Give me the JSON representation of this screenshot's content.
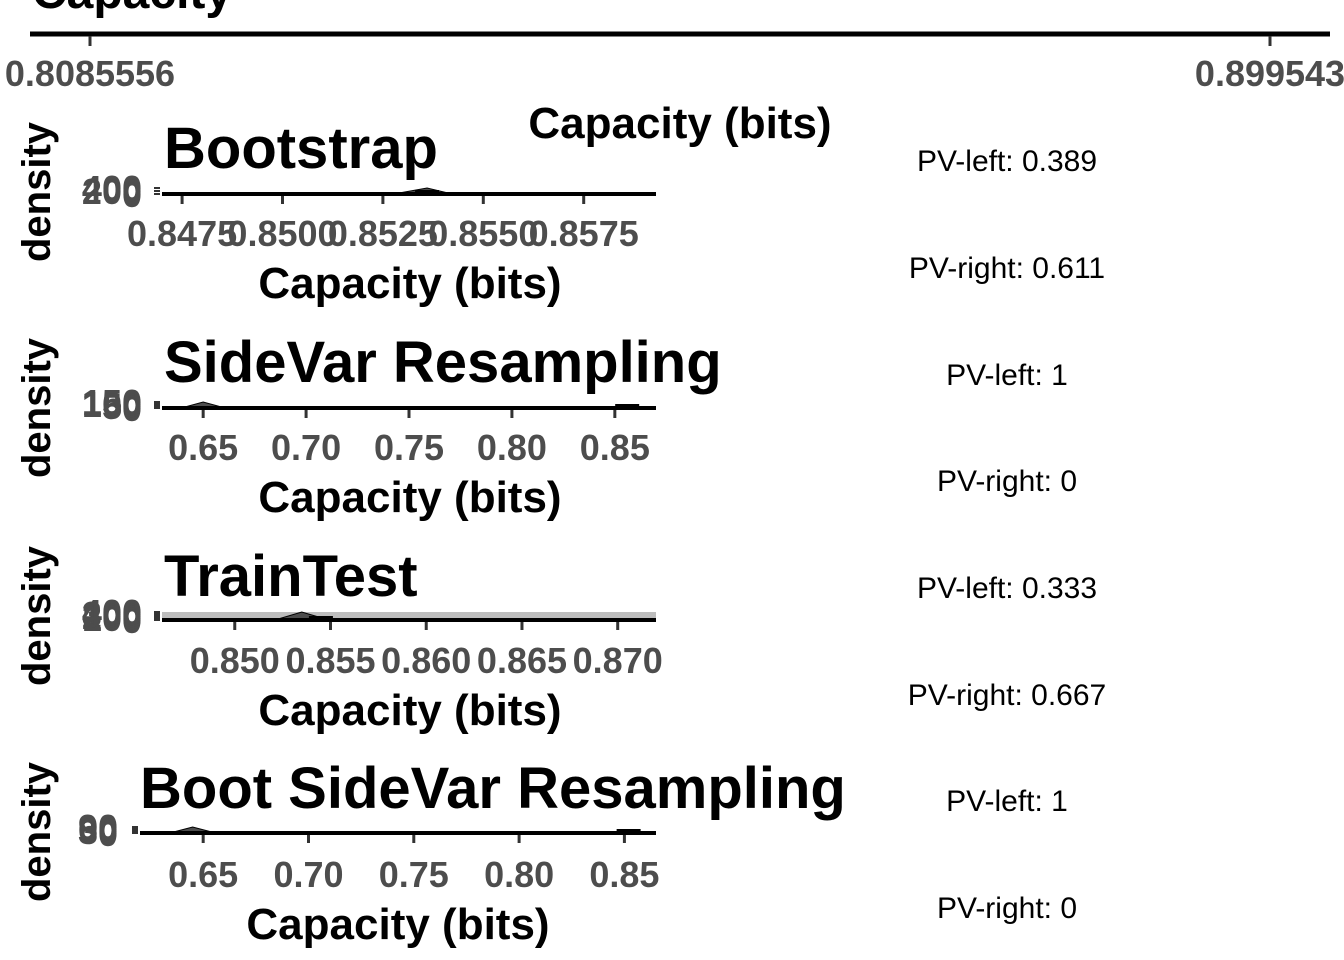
{
  "top_panel": {
    "title": "Capacity",
    "xlabel": "Capacity (bits)",
    "tick_labels": [
      "0.8085556",
      "0.899543"
    ]
  },
  "pv_labels": [
    "PV-left: 0.389",
    "PV-right: 0.611",
    "PV-left: 1",
    "PV-right: 0",
    "PV-left: 0.333",
    "PV-right: 0.667",
    "PV-left: 1",
    "PV-right: 0"
  ],
  "chart_data": [
    {
      "type": "area",
      "title": "Bootstrap",
      "xlabel": "Capacity (bits)",
      "ylabel": "density",
      "x_ticks": [
        0.8475,
        0.85,
        0.8525,
        0.855,
        0.8575
      ],
      "x_tick_labels": [
        "0.8475",
        "0.8500",
        "0.8525",
        "0.8550",
        "0.8575"
      ],
      "y_ticks": [
        0,
        200,
        400
      ],
      "y_tick_labels": [
        "0",
        "200",
        "400"
      ],
      "xlim": [
        0.847,
        0.8593
      ],
      "ylim": [
        0,
        400
      ],
      "x": [
        0.847,
        0.8518,
        0.8528,
        0.8536,
        0.8542,
        0.855,
        0.8593
      ],
      "y": [
        0,
        0,
        20,
        400,
        20,
        0,
        0
      ],
      "observed": 0.8536
    },
    {
      "type": "area",
      "title": "SideVar Resampling",
      "xlabel": "Capacity (bits)",
      "ylabel": "density",
      "x_ticks": [
        0.65,
        0.7,
        0.75,
        0.8,
        0.85
      ],
      "x_tick_labels": [
        "0.65",
        "0.70",
        "0.75",
        "0.80",
        "0.85"
      ],
      "y_ticks": [
        0,
        50,
        100,
        150
      ],
      "y_tick_labels": [
        "0",
        "50",
        "100",
        "150"
      ],
      "xlim": [
        0.63,
        0.87
      ],
      "ylim": [
        0,
        150
      ],
      "x": [
        0.63,
        0.64,
        0.65,
        0.66,
        0.67,
        0.87
      ],
      "y": [
        0,
        10,
        150,
        10,
        0,
        0
      ],
      "observed": 0.856
    },
    {
      "type": "area",
      "title": "TrainTest",
      "xlabel": "Capacity (bits)",
      "ylabel": "density",
      "x_ticks": [
        0.85,
        0.855,
        0.86,
        0.865,
        0.87
      ],
      "x_tick_labels": [
        "0.850",
        "0.855",
        "0.860",
        "0.865",
        "0.870"
      ],
      "y_ticks": [
        0,
        100,
        200,
        300,
        400
      ],
      "y_tick_labels": [
        "0",
        "100",
        "200",
        "300",
        "400"
      ],
      "xlim": [
        0.8462,
        0.872
      ],
      "ylim": [
        0,
        400
      ],
      "x": [
        0.8462,
        0.8505,
        0.8522,
        0.8535,
        0.8548,
        0.8565,
        0.872
      ],
      "y": [
        0,
        0,
        30,
        400,
        30,
        0,
        0
      ],
      "observed": 0.8545
    },
    {
      "type": "area",
      "title": "Boot SideVar Resampling",
      "xlabel": "Capacity (bits)",
      "ylabel": "density",
      "x_ticks": [
        0.65,
        0.7,
        0.75,
        0.8,
        0.85
      ],
      "x_tick_labels": [
        "0.65",
        "0.70",
        "0.75",
        "0.80",
        "0.85"
      ],
      "y_ticks": [
        0,
        30,
        60,
        90
      ],
      "y_tick_labels": [
        "0",
        "30",
        "60",
        "90"
      ],
      "xlim": [
        0.62,
        0.865
      ],
      "ylim": [
        0,
        90
      ],
      "x": [
        0.62,
        0.635,
        0.645,
        0.655,
        0.665,
        0.865
      ],
      "y": [
        0,
        8,
        90,
        8,
        0,
        0
      ],
      "observed": 0.852
    }
  ]
}
